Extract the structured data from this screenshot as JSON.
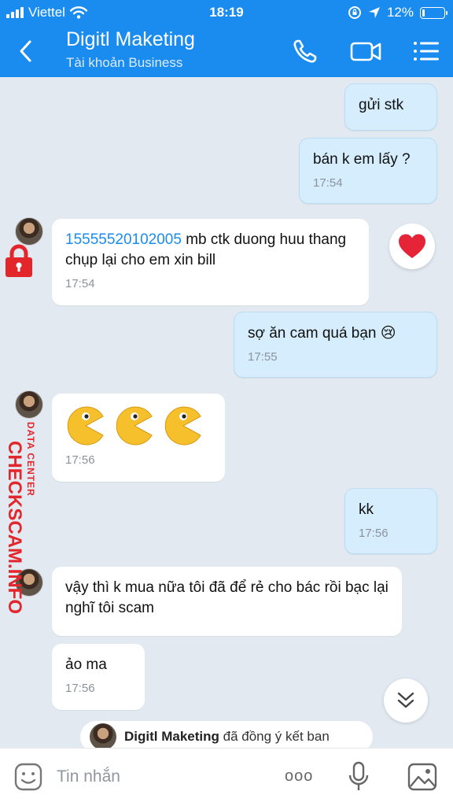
{
  "status_bar": {
    "carrier": "Viettel",
    "time": "18:19",
    "battery": "12%",
    "battery_level": 0.12
  },
  "header": {
    "name": "Digitl Maketing",
    "subtitle": "Tài khoản Business"
  },
  "icons": {
    "back": "chevron-left-icon",
    "call": "phone-icon",
    "video": "video-camera-icon",
    "menu": "list-menu-icon",
    "heart": "heart-icon",
    "scroll": "double-chevron-down-icon",
    "sticker": "sticker-icon",
    "more": "more-dots-icon",
    "mic": "microphone-icon",
    "image": "image-icon"
  },
  "colors": {
    "accent": "#1a8cf0",
    "outgoing_bubble": "#d5edfc",
    "incoming_bubble": "#ffffff",
    "watermark": "#e3262b"
  },
  "messages": [
    {
      "direction": "out",
      "text": "gửi stk",
      "time": ""
    },
    {
      "direction": "out",
      "text": "bán k em lấy ?",
      "time": "17:54"
    },
    {
      "direction": "in",
      "phone": "15555520102005",
      "text": " mb ctk duong huu thang chụp lại cho em xin bill",
      "time": "17:54"
    },
    {
      "direction": "out",
      "text": "sợ ăn cam quá bạn 😢",
      "time": "17:55"
    },
    {
      "direction": "in",
      "text": "😋 😋 😋",
      "time": "17:56"
    },
    {
      "direction": "out",
      "text": "kk",
      "time": "17:56"
    },
    {
      "direction": "in",
      "text": "vậy thì k mua nữa tôi đã để rẻ cho bác rồi bạc lại nghĩ tôi scam",
      "time": ""
    },
    {
      "direction": "in",
      "text": "ảo ma",
      "time": "17:56"
    }
  ],
  "watermark": {
    "small": "DATA CENTER",
    "big": "CHECKSCAM.INFO"
  },
  "system_message": {
    "name": "Digitl Maketing",
    "text": " đã đồng ý kết ban"
  },
  "input": {
    "placeholder": "Tin nhắn",
    "more_dots": "ooo"
  }
}
